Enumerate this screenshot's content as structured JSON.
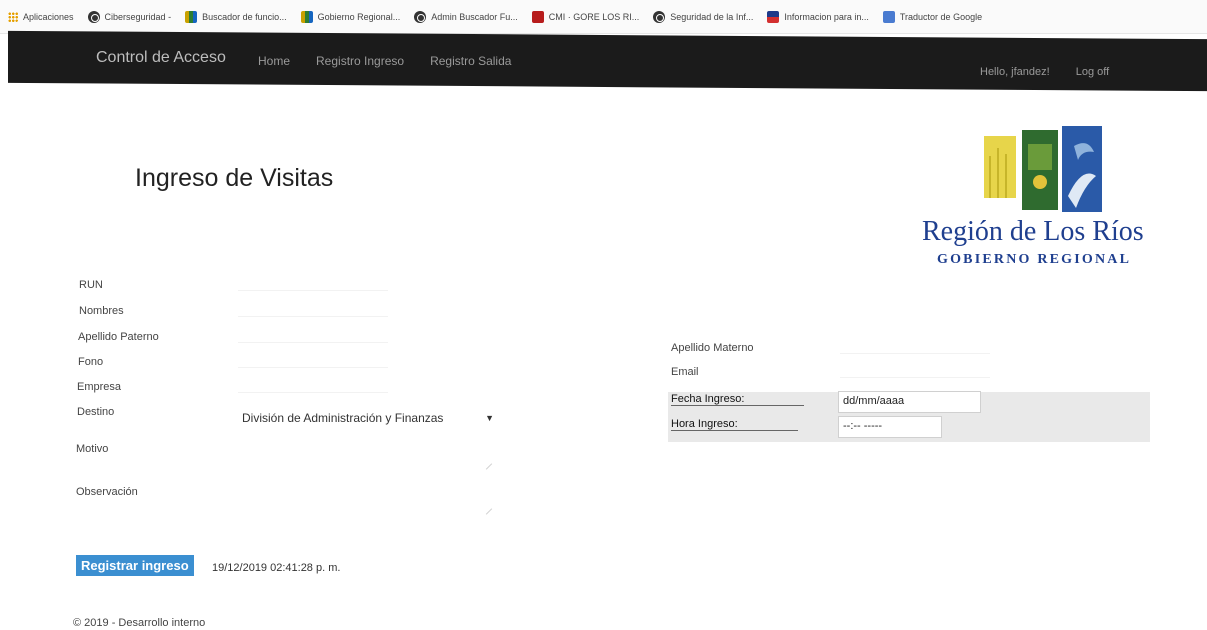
{
  "bookmarks": [
    {
      "icon": "apps-icon",
      "label": "Aplicaciones"
    },
    {
      "icon": "globe-icon",
      "label": "Ciberseguridad -"
    },
    {
      "icon": "gore-icon",
      "label": "Buscador de funcio..."
    },
    {
      "icon": "gore-icon",
      "label": "Gobierno Regional..."
    },
    {
      "icon": "globe-icon",
      "label": "Admin Buscador Fu..."
    },
    {
      "icon": "cmi-icon",
      "label": "CMI · GORE LOS RI..."
    },
    {
      "icon": "globe-icon",
      "label": "Seguridad de la Inf..."
    },
    {
      "icon": "flag-icon",
      "label": "Informacion para in..."
    },
    {
      "icon": "translate-icon",
      "label": "Traductor de Google"
    }
  ],
  "navbar": {
    "brand": "Control de Acceso",
    "links": [
      "Home",
      "Registro Ingreso",
      "Registro Salida"
    ],
    "greeting": "Hello, jfandez!",
    "logoff": "Log off",
    "bg_color": "#1b1b1b"
  },
  "page": {
    "title": "Ingreso de Visitas"
  },
  "logo": {
    "title": "Región de Los Ríos",
    "subtitle": "GOBIERNO REGIONAL",
    "color": "#1f3f8f"
  },
  "form_left": {
    "run": "RUN",
    "nombres": "Nombres",
    "apellido_paterno": "Apellido Paterno",
    "fono": "Fono",
    "empresa": "Empresa",
    "destino": "Destino",
    "destino_value": "División de Administración y Finanzas",
    "motivo": "Motivo",
    "observacion": "Observación"
  },
  "form_right": {
    "apellido_materno": "Apellido Materno",
    "email": "Email",
    "fecha_ingreso": "Fecha Ingreso:",
    "fecha_placeholder": "dd/mm/aaaa",
    "hora_ingreso": "Hora Ingreso:",
    "hora_placeholder": "--:-- -----"
  },
  "submit": {
    "label": "Registrar ingreso",
    "timestamp": "19/12/2019 02:41:28 p. m.",
    "color": "#3b8fd1"
  },
  "footer": {
    "text": "© 2019 - Desarrollo interno"
  }
}
